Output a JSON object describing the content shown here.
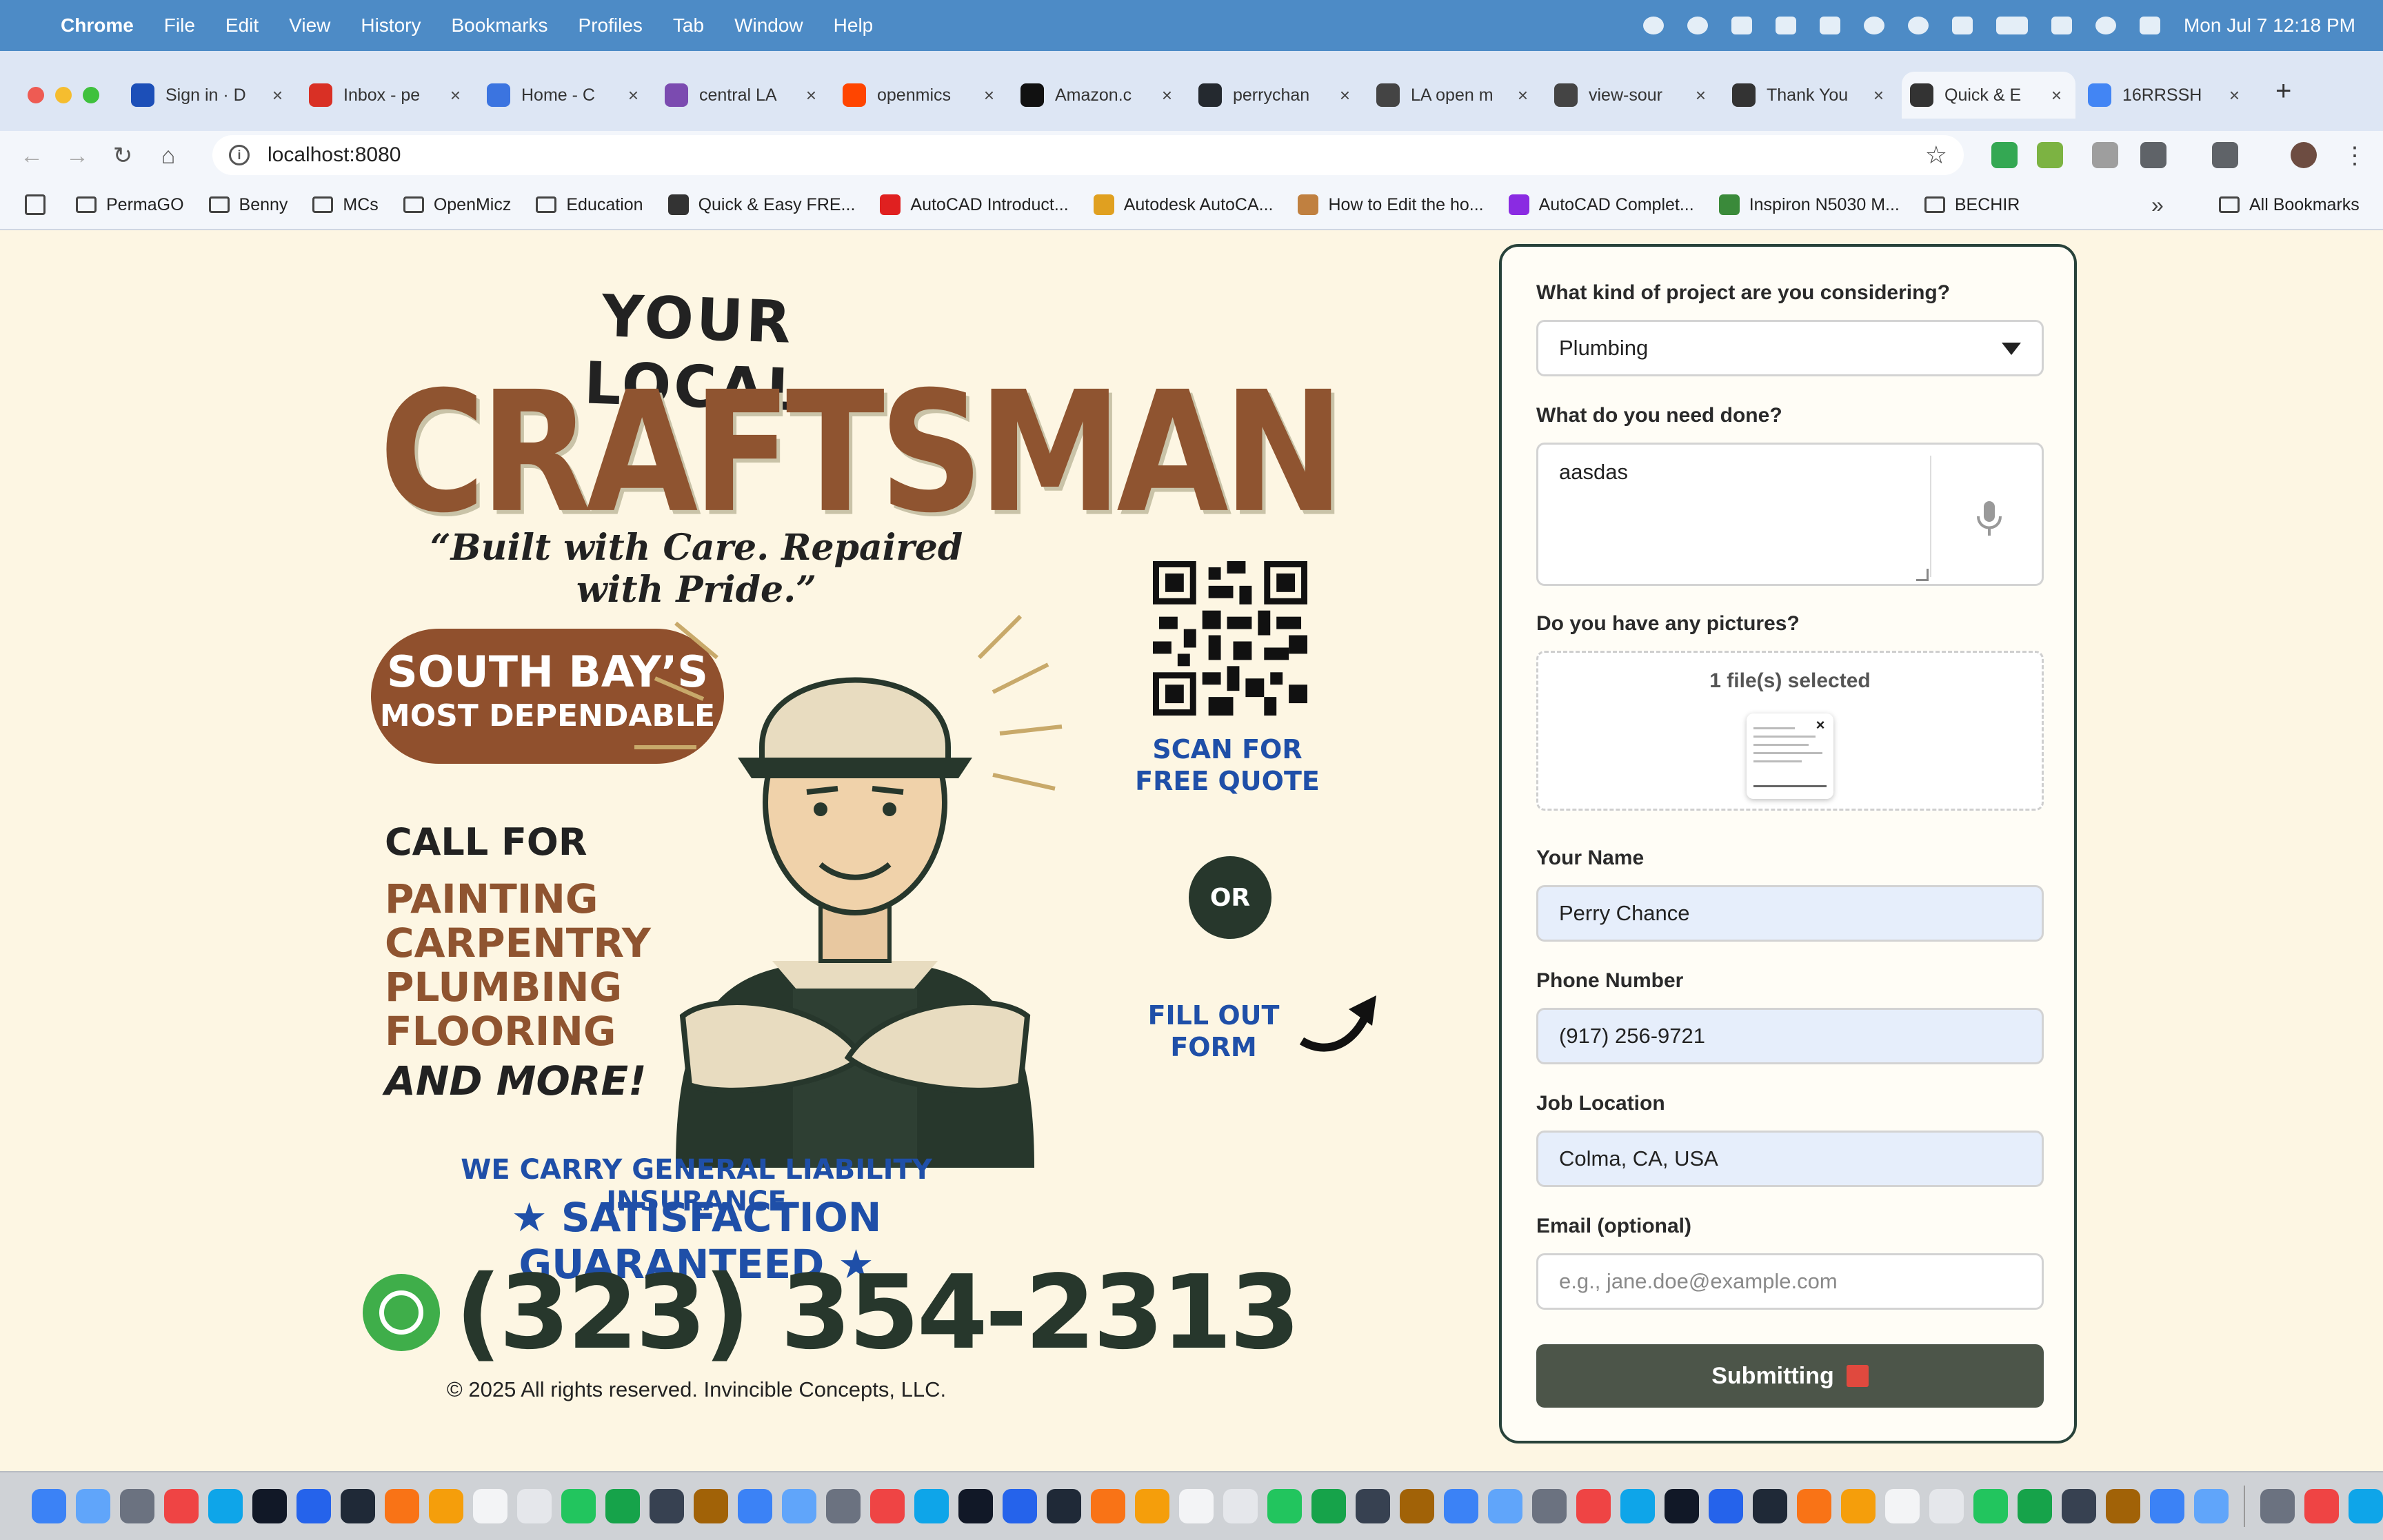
{
  "menubar": {
    "app": "Chrome",
    "items": [
      "File",
      "Edit",
      "View",
      "History",
      "Bookmarks",
      "Profiles",
      "Tab",
      "Window",
      "Help"
    ],
    "clock": "Mon Jul 7  12:18 PM"
  },
  "tabs": [
    {
      "title": "Sign in · D",
      "icon": "profile-icon",
      "color": "#1c4fb8"
    },
    {
      "title": "Inbox - pe",
      "icon": "gmail-icon",
      "color": "#d93025"
    },
    {
      "title": "Home - C",
      "icon": "site-icon",
      "color": "#3b74e0"
    },
    {
      "title": "central LA",
      "icon": "peace-icon",
      "color": "#7b4bb0"
    },
    {
      "title": "openmics",
      "icon": "reddit-icon",
      "color": "#ff4500"
    },
    {
      "title": "Amazon.c",
      "icon": "amazon-icon",
      "color": "#111111"
    },
    {
      "title": "perrychan",
      "icon": "github-icon",
      "color": "#24292f"
    },
    {
      "title": "LA open m",
      "icon": "cube-icon",
      "color": "#444444"
    },
    {
      "title": "view-sour",
      "icon": "cube-icon",
      "color": "#444444"
    },
    {
      "title": "Thank You",
      "icon": "hammer-icon",
      "color": "#333333"
    },
    {
      "title": "Quick & E",
      "icon": "hammer-icon",
      "color": "#333333"
    },
    {
      "title": "16RRSSH",
      "icon": "google-icon",
      "color": "#4285f4"
    }
  ],
  "active_tab_index": 10,
  "address": {
    "url": "localhost:8080"
  },
  "bookmarks": [
    {
      "label": "PermaGO",
      "type": "folder"
    },
    {
      "label": "Benny",
      "type": "folder"
    },
    {
      "label": "MCs",
      "type": "folder"
    },
    {
      "label": "OpenMicz",
      "type": "folder"
    },
    {
      "label": "Education",
      "type": "folder"
    },
    {
      "label": "Quick & Easy FRE...",
      "type": "link",
      "color": "#333333"
    },
    {
      "label": "AutoCAD Introduct...",
      "type": "link",
      "color": "#e02020"
    },
    {
      "label": "Autodesk AutoCA...",
      "type": "link",
      "color": "#e0a020"
    },
    {
      "label": "How to Edit the ho...",
      "type": "link",
      "color": "#c08040"
    },
    {
      "label": "AutoCAD Complet...",
      "type": "link",
      "color": "#8a2be2"
    },
    {
      "label": "Inspiron N5030 M...",
      "type": "link",
      "color": "#3a8a3a"
    },
    {
      "label": "BECHIR",
      "type": "folder"
    }
  ],
  "all_bookmarks": "All Bookmarks",
  "flyer": {
    "your_local": "YOUR LOCAL",
    "brand": "CRAFTSMAN",
    "tagline": "“Built with Care. Repaired with Pride.”",
    "badge_line1": "SOUTH BAY’S",
    "badge_line2": "MOST DEPENDABLE",
    "call_for": "CALL FOR",
    "services": [
      "PAINTING",
      "CARPENTRY",
      "PLUMBING",
      "FLOORING"
    ],
    "and_more": "AND MORE!",
    "scan_line1": "SCAN FOR",
    "scan_line2": "FREE QUOTE",
    "or": "OR",
    "fill_line1": "FILL OUT",
    "fill_line2": "FORM",
    "insurance": "WE CARRY GENERAL LIABILITY INSURANCE",
    "satisfaction": "★ SATISFACTION GUARANTEED ★",
    "phone": "(323) 354-2313",
    "copyright": "© 2025 All rights reserved.  Invincible Concepts, LLC."
  },
  "form": {
    "project_label": "What kind of project are you considering?",
    "project_value": "Plumbing",
    "need_label": "What do you need done?",
    "need_value": "aasdas",
    "pictures_label": "Do you have any pictures?",
    "files_selected": "1 file(s) selected",
    "remove_glyph": "×",
    "name_label": "Your Name",
    "name_value": "Perry Chance",
    "phone_label": "Phone Number",
    "phone_value": "(917) 256-9721",
    "location_label": "Job Location",
    "location_value": "Colma, CA, USA",
    "email_label": "Email (optional)",
    "email_placeholder": "e.g., jane.doe@example.com",
    "submit_label": "Submitting"
  },
  "colors": {
    "page_bg": "#fdf6e3",
    "brand_brown": "#8f5430",
    "accent_blue": "#1f4fa8",
    "dark_green": "#27372c",
    "submit_bg": "#4c5549",
    "submit_indicator": "#e0493e",
    "whatsapp": "#3fae4a"
  },
  "dock": {
    "apps": [
      "finder",
      "launchpad",
      "settings",
      "calendar",
      "mail",
      "terminal",
      "vscode",
      "word-app",
      "claude",
      "files",
      "notes",
      "reminders",
      "messages",
      "facetime",
      "app-store-tools",
      "keka",
      "chrome",
      "brave",
      "firefox",
      "safari",
      "music",
      "spotify",
      "quicktime",
      "photos",
      "screenshot",
      "skype",
      "remote",
      "messenger",
      "app-store",
      "stickies",
      "preview",
      "calculator",
      "voice-memo",
      "discord",
      "teams",
      "whatsapp",
      "evernote",
      "photoshop",
      "trello",
      "sketchup",
      "chatgpt",
      "flight",
      "tor",
      "obs",
      "bird",
      "maps",
      "acrobat",
      "anydesk",
      "drive",
      "dictionary",
      "archive",
      "iphone-mirror",
      "trash"
    ]
  }
}
